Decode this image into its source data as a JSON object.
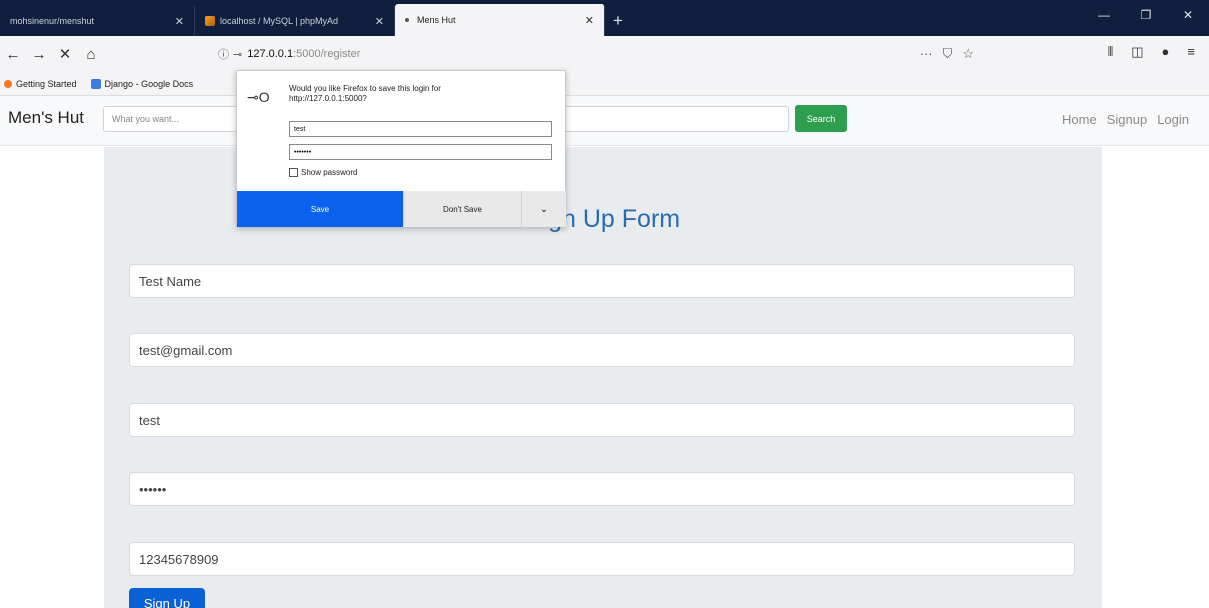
{
  "browser": {
    "tabs": [
      {
        "label": "mohsinenur/menshut",
        "close": "✕"
      },
      {
        "label": "localhost / MySQL | phpMyAd",
        "close": "✕"
      },
      {
        "label": "Mens Hut",
        "close": "✕"
      }
    ],
    "new_tab": "+",
    "window_controls": [
      "—",
      "❐",
      "✕"
    ],
    "url": {
      "host": "127.0.0.1",
      "path": ":5000/register"
    },
    "nav": {
      "back": "←",
      "forward": "→",
      "stop": "✕",
      "home": "⌂"
    },
    "url_actions": [
      "···",
      "⛉",
      "☆"
    ],
    "toolbar_right": [
      "⫴",
      "◫",
      "●",
      "≡"
    ],
    "bookmarks": [
      "Getting Started",
      "Django - Google Docs"
    ]
  },
  "site": {
    "brand": "Men's Hut",
    "search_placeholder": "What you want...",
    "search_button": "Search",
    "links": [
      "Home",
      "Signup",
      "Login"
    ]
  },
  "form": {
    "title": "Sign Up Form",
    "fields": [
      {
        "value": "Test Name"
      },
      {
        "value": "test@gmail.com"
      },
      {
        "value": "test"
      },
      {
        "value": "••••••"
      },
      {
        "value": "12345678909"
      }
    ],
    "submit": "Sign Up"
  },
  "popup": {
    "message": "Would you like Firefox to save this login for http://127.0.0.1:5000?",
    "username": "test",
    "password": "•••••••",
    "show_password": "Show password",
    "save": "Save",
    "dont_save": "Don't Save",
    "more": "⌄"
  },
  "colors": {
    "tabbar": "#0f1f3d",
    "search_button": "#2e9e4f",
    "primary": "#0b62d6",
    "form_title": "#2b6cb0",
    "panel": "#e9ecef"
  }
}
